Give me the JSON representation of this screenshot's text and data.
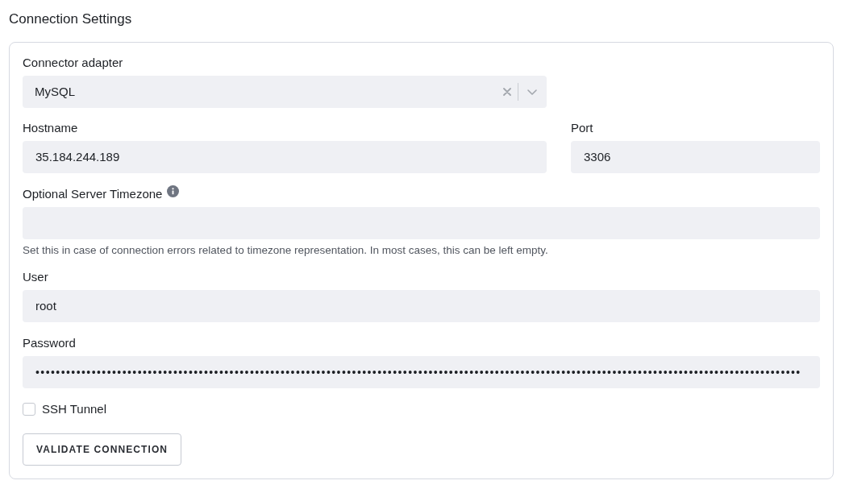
{
  "title": "Connection Settings",
  "connector_adapter": {
    "label": "Connector adapter",
    "value": "MySQL"
  },
  "hostname": {
    "label": "Hostname",
    "value": "35.184.244.189"
  },
  "port": {
    "label": "Port",
    "value": "3306"
  },
  "server_timezone": {
    "label": "Optional Server Timezone",
    "help": "Set this in case of connection errors related to timezone representation. In most cases, this can be left empty."
  },
  "user": {
    "label": "User",
    "value": "root"
  },
  "password": {
    "label": "Password",
    "value": "••••••••••••••••••••••••••••••••••••••••••••••••••••••••••••••••••••••••••••••••••••••••••••••••••••••••••••••••••••••••••••••••••••••••••••••••••••••"
  },
  "ssh_tunnel": {
    "label": "SSH Tunnel",
    "checked": false
  },
  "validate_button": {
    "label": "VALIDATE CONNECTION"
  }
}
